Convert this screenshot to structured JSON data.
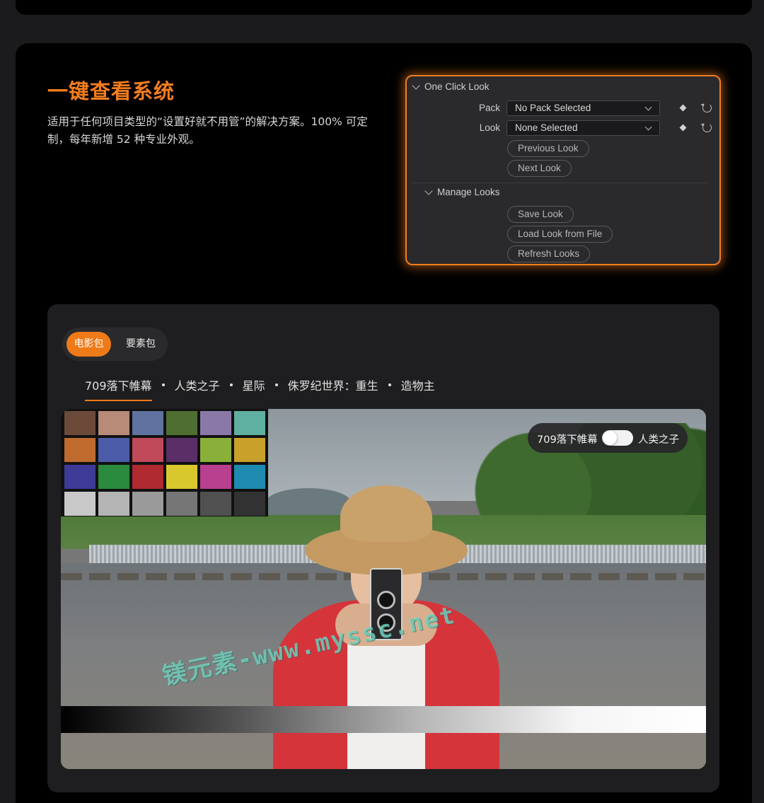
{
  "hero": {
    "title": "一键查看系统",
    "description": "适用于任何项目类型的“设置好就不用管”的解决方案。100% 可定制，每年新增 52 种专业外观。"
  },
  "panel": {
    "section_title": "One Click Look",
    "pack_label": "Pack",
    "pack_value": "No Pack Selected",
    "look_label": "Look",
    "look_value": "None Selected",
    "buttons": [
      "Previous Look",
      "Next Look"
    ],
    "manage_title": "Manage Looks",
    "manage_buttons": [
      "Save Look",
      "Load Look from File",
      "Refresh Looks"
    ]
  },
  "tabs": {
    "active": "电影包",
    "inactive": "要素包"
  },
  "films": [
    "709落下帷幕",
    "人类之子",
    "星际",
    "侏罗纪世界：重生",
    "造物主"
  ],
  "compare": {
    "left": "709落下帷幕",
    "right": "人类之子"
  },
  "watermark": "镁元素-www.myssc.net",
  "colors": {
    "accent": "#ef7a18",
    "checker": [
      "#6b4a3a",
      "#b88a78",
      "#5f72a0",
      "#4e6e32",
      "#8a79a8",
      "#5fb0a0",
      "#bf6a2e",
      "#4c5ca8",
      "#c04a5a",
      "#5a2e66",
      "#8ab03a",
      "#c8a02a",
      "#3e3a98",
      "#2a8a3e",
      "#b02a32",
      "#d8c82e",
      "#b8408e",
      "#1e8ab0",
      "#c8c8c8",
      "#b4b4b4",
      "#9a9a9a",
      "#767676",
      "#505050",
      "#323232"
    ]
  }
}
